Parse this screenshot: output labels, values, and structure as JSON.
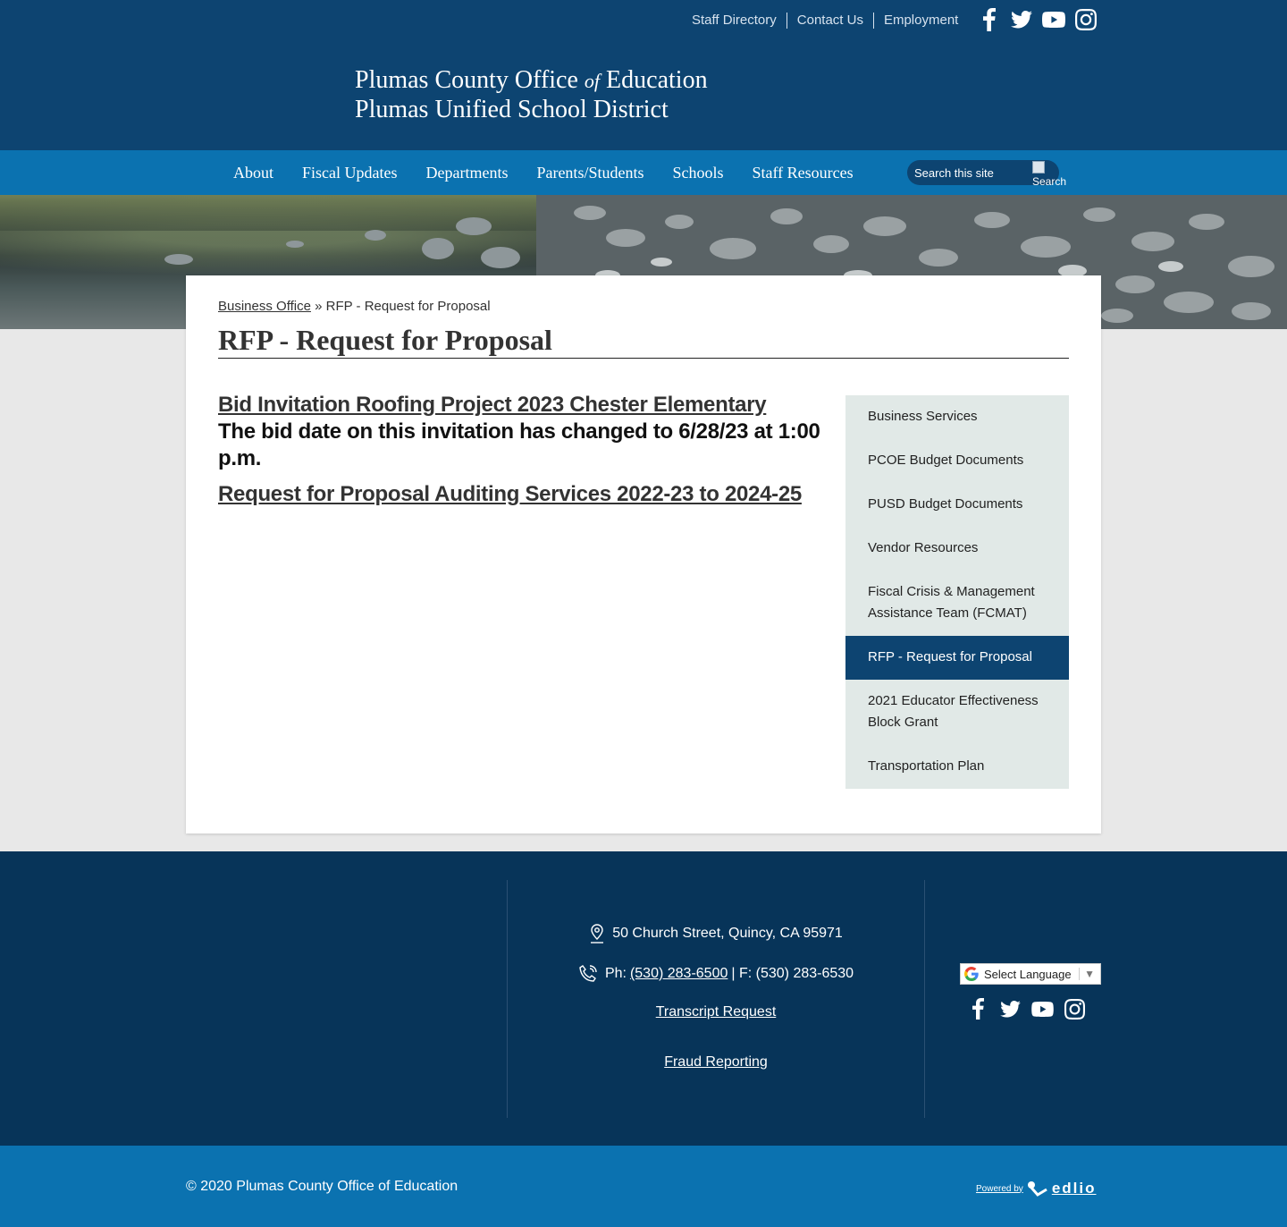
{
  "header": {
    "utility_links": [
      "Staff Directory",
      "Contact Us",
      "Employment"
    ],
    "title_line1_pre": "Plumas County Office",
    "title_line1_of": "of",
    "title_line1_post": "Education",
    "title_line2": "Plumas Unified School District",
    "social_icons": [
      "facebook-icon",
      "twitter-icon",
      "youtube-icon",
      "instagram-icon"
    ]
  },
  "nav": {
    "items": [
      "About",
      "Fiscal Updates",
      "Departments",
      "Parents/Students",
      "Schools",
      "Staff Resources"
    ],
    "search_placeholder": "Search this site",
    "search_button": "Search"
  },
  "content": {
    "breadcrumb_link": "Business Office",
    "breadcrumb_sep": "»",
    "breadcrumb_current": "RFP - Request for Proposal",
    "page_title": "RFP - Request for Proposal",
    "link1": "Bid Invitation Roofing Project 2023 Chester Elementary",
    "note1": "The bid date on this invitation has changed to 6/28/23 at 1:00 p.m.",
    "link2": "Request for Proposal Auditing Services 2022-23 to 2024-25"
  },
  "side_nav": {
    "items": [
      "Business Services",
      "PCOE Budget Documents",
      "PUSD Budget Documents",
      "Vendor Resources",
      "Fiscal Crisis & Management Assistance Team (FCMAT)",
      "RFP - Request for Proposal",
      "2021 Educator Effectiveness Block Grant",
      "Transportation Plan"
    ],
    "active_index": 5
  },
  "footer": {
    "address": "50 Church Street, Quincy, CA 95971",
    "phone_prefix": "Ph:",
    "phone": "(530) 283-6500",
    "fax": "| F: (530) 283-6530",
    "transcript": "Transcript Request",
    "fraud": "Fraud Reporting",
    "translate": "Select Language",
    "translate_arrow": "▼",
    "copyright": "© 2020 Plumas County Office of Education",
    "powered_by": "Powered by",
    "brand": "edlio"
  },
  "colors": {
    "header_bg": "#0d4471",
    "nav_bg": "#0b72b0",
    "footer_bg": "#073459",
    "sidebar_bg": "#e1e9e7",
    "active_bg": "#0d4471"
  }
}
